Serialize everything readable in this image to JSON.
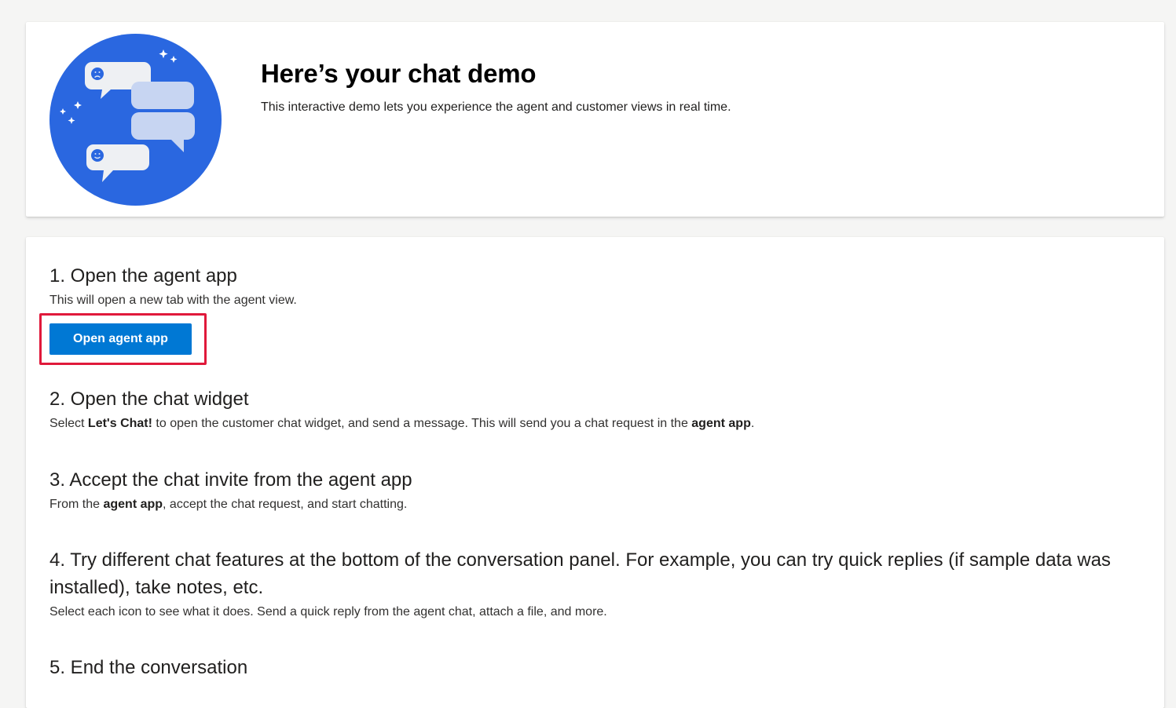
{
  "header": {
    "title": "Here’s your chat demo",
    "subtitle": "This interactive demo lets you experience the agent and customer views in real time."
  },
  "illustration": {
    "icon": "chat-bubbles-illustration",
    "circle_color": "#2a67e0",
    "bubble_color": "#dce6f7"
  },
  "steps": [
    {
      "title": "1. Open the agent app",
      "desc_parts": [
        "This will open a new tab with the agent view."
      ],
      "button_label": "Open agent app"
    },
    {
      "title": "2. Open the chat widget",
      "desc_parts": [
        "Select ",
        "Let's Chat!",
        " to open the customer chat widget, and send a message. This will send you a chat request in the ",
        "agent app",
        "."
      ]
    },
    {
      "title": "3. Accept the chat invite from the agent app",
      "desc_parts": [
        "From the ",
        "agent app",
        ", accept the chat request, and start chatting."
      ]
    },
    {
      "title": "4. Try different chat features at the bottom of the conversation panel. For example, you can try quick replies (if sample data was installed), take notes, etc.",
      "desc_parts": [
        "Select each icon to see what it does. Send a quick reply from the agent chat, attach a file, and more."
      ]
    },
    {
      "title": "5. End the conversation"
    }
  ],
  "colors": {
    "primary": "#0078d4",
    "highlight": "#e0193b",
    "page_background": "#f5f5f4"
  }
}
